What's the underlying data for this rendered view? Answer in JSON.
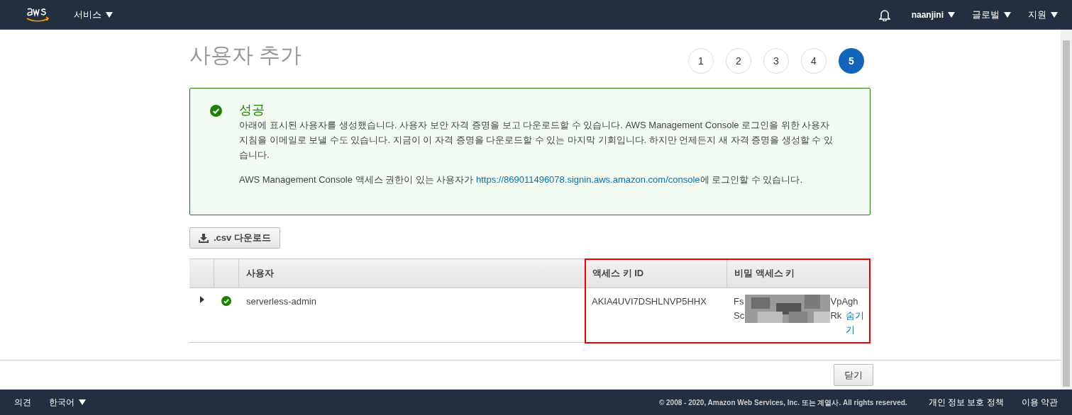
{
  "nav": {
    "services": "서비스",
    "user": "naanjini",
    "region": "글로벌",
    "support": "지원"
  },
  "page": {
    "title": "사용자 추가",
    "steps": [
      {
        "label": "1",
        "selected": false
      },
      {
        "label": "2",
        "selected": false
      },
      {
        "label": "3",
        "selected": false
      },
      {
        "label": "4",
        "selected": false
      },
      {
        "label": "5",
        "selected": true
      }
    ]
  },
  "alert": {
    "title": "성공",
    "message": "아래에 표시된 사용자를 생성했습니다. 사용자 보안 자격 증명을 보고 다운로드할 수 있습니다. AWS Management Console 로그인을 위한 사용자 지침을 이메일로 보낼 수도 있습니다. 지금이 이 자격 증명을 다운로드할 수 있는 마지막 기회입니다. 하지만 언제든지 새 자격 증명을 생성할 수 있습니다.",
    "login_before": "AWS Management Console 액세스 권한이 있는 사용자가 ",
    "login_link": "https://869011496078.signin.aws.amazon.com/console",
    "login_after": "에 로그인할 수 있습니다."
  },
  "download_button": ".csv 다운로드",
  "table": {
    "columns": [
      "사용자",
      "액세스 키 ID",
      "비밀 액세스 키"
    ],
    "rows": [
      {
        "expanded": false,
        "user": "serverless-admin",
        "access_key_id": "AKIA4UVI7DSHLNVP5HHX",
        "secret_line_1_start": "Fs",
        "secret_line_1_end": "VpAgh",
        "secret_line_2_start": "Sc",
        "secret_line_2_end": "Rk",
        "hide_link": "숨기기"
      }
    ]
  },
  "close_button": "닫기",
  "footer": {
    "feedback": "의견",
    "language": "한국어",
    "copyright": "© 2008 - 2020, Amazon Web Services, Inc. 또는 계열사. All rights reserved.",
    "privacy": "개인 정보 보호 정책",
    "terms": "이용 약관"
  }
}
